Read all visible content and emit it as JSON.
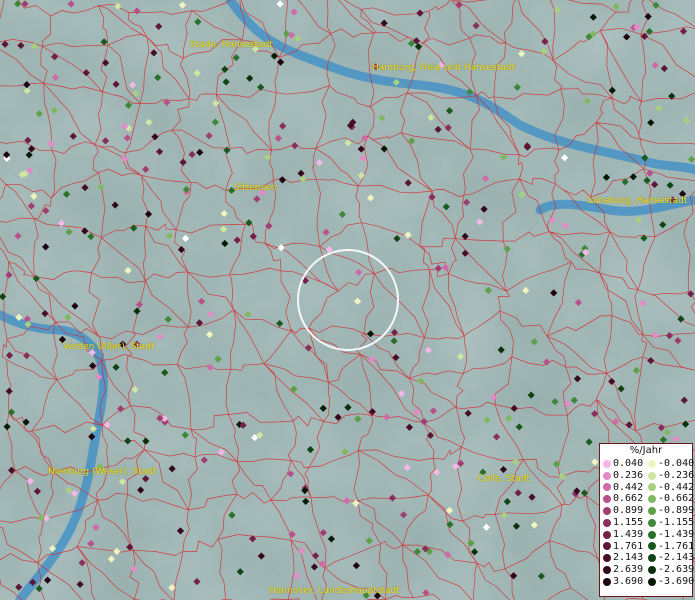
{
  "places": [
    {
      "name": "Stade, Hansestadt"
    },
    {
      "name": "Hamburg, Freie und Hansestadt"
    },
    {
      "name": "Sittensen"
    },
    {
      "name": "Lüneburg, Hansestadt"
    },
    {
      "name": "Verden (Aller), Stadt"
    },
    {
      "name": "Nienburg (Weser), Stadt"
    },
    {
      "name": "Celle, Stadt"
    },
    {
      "name": "Hannover, Landeshauptstadt"
    }
  ],
  "legend": {
    "title": "%/Jahr",
    "positive": [
      {
        "label": "0.040",
        "color": "#f4b8e8"
      },
      {
        "label": "0.236",
        "color": "#e48ac8"
      },
      {
        "label": "0.442",
        "color": "#d06aa8"
      },
      {
        "label": "0.662",
        "color": "#b8508c"
      },
      {
        "label": "0.899",
        "color": "#a03e72"
      },
      {
        "label": "1.155",
        "color": "#8a2e5c"
      },
      {
        "label": "1.439",
        "color": "#74204a"
      },
      {
        "label": "1.761",
        "color": "#5e1638"
      },
      {
        "label": "2.143",
        "color": "#480e28"
      },
      {
        "label": "2.639",
        "color": "#34081c"
      },
      {
        "label": "3.690",
        "color": "#1c0210"
      }
    ],
    "negative": [
      {
        "label": "-0.040",
        "color": "#f0f5c0"
      },
      {
        "label": "-0.236",
        "color": "#cfe6a0"
      },
      {
        "label": "-0.442",
        "color": "#a8d080"
      },
      {
        "label": "-0.662",
        "color": "#80b860"
      },
      {
        "label": "-0.899",
        "color": "#5ca048"
      },
      {
        "label": "-1.155",
        "color": "#3e8838"
      },
      {
        "label": "-1.439",
        "color": "#2a702a"
      },
      {
        "label": "-1.761",
        "color": "#1a5a1e"
      },
      {
        "label": "-2.143",
        "color": "#104414"
      },
      {
        "label": "-2.639",
        "color": "#08300c"
      },
      {
        "label": "-3.690",
        "color": "#021a04"
      }
    ]
  },
  "colors": {
    "boundary": "#d8262a",
    "river": "#3a8cc8",
    "label": "#f1e21c",
    "marker_ring": "#ffffff"
  }
}
